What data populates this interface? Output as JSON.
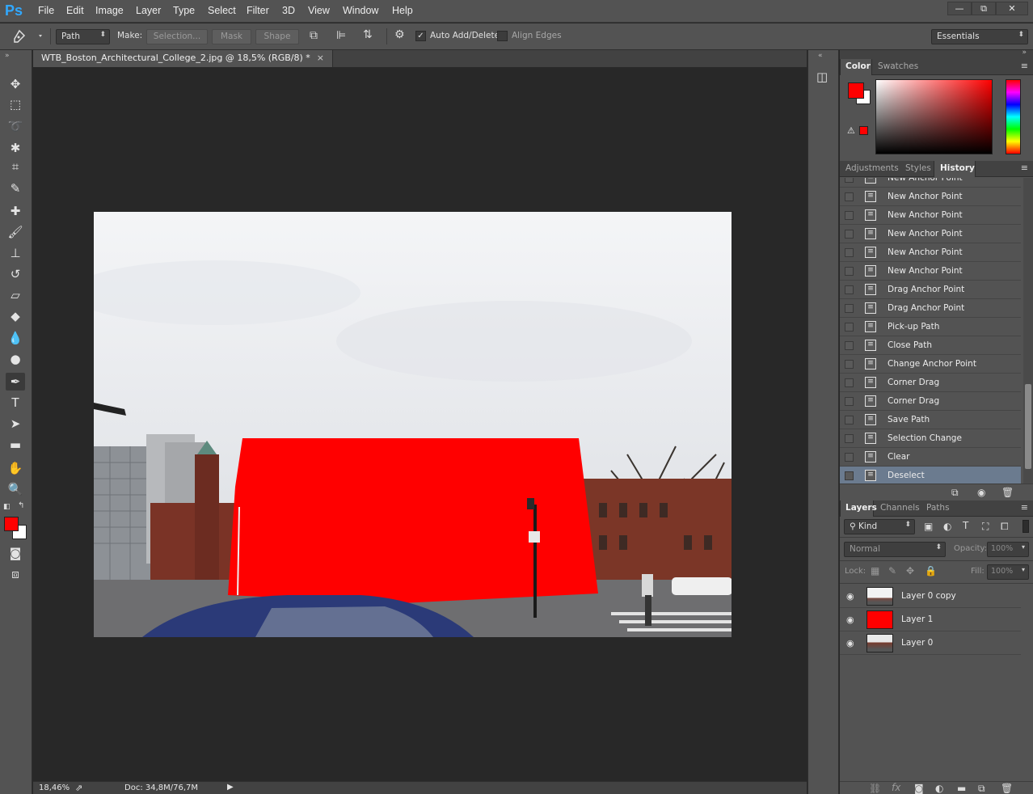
{
  "app": {
    "logo": "Ps"
  },
  "menu": [
    "File",
    "Edit",
    "Image",
    "Layer",
    "Type",
    "Select",
    "Filter",
    "3D",
    "View",
    "Window",
    "Help"
  ],
  "window_controls": {
    "minimize": "—",
    "restore": "⧉",
    "close": "✕"
  },
  "options_bar": {
    "mode_value": "Path",
    "make_label": "Make:",
    "selection_label": "Selection...",
    "mask_label": "Mask",
    "shape_label": "Shape",
    "auto_add_delete_label": "Auto Add/Delete",
    "auto_add_delete_checked": true,
    "align_edges_label": "Align Edges",
    "align_edges_checked": false,
    "workspace_value": "Essentials"
  },
  "document": {
    "tab_title": "WTB_Boston_Architectural_College_2.jpg @ 18,5% (RGB/8) *",
    "zoom": "18,46%",
    "doc_info": "Doc: 34,8M/76,7M"
  },
  "colors": {
    "foreground": "#ff0000",
    "background": "#ffffff",
    "accent": "#31a8ff",
    "fill_layer": "#ff0000",
    "history_selected": "#6b7b8f"
  },
  "color_panel": {
    "tabs": [
      "Color",
      "Swatches"
    ]
  },
  "history_panel": {
    "tabs": [
      "Adjustments",
      "Styles",
      "History"
    ],
    "items": [
      "New Anchor Point",
      "New Anchor Point",
      "New Anchor Point",
      "New Anchor Point",
      "New Anchor Point",
      "New Anchor Point",
      "Drag Anchor Point",
      "Drag Anchor Point",
      "Pick-up Path",
      "Close Path",
      "Change Anchor Point",
      "Corner Drag",
      "Corner Drag",
      "Save Path",
      "Selection Change",
      "Clear",
      "Deselect"
    ],
    "selected_index": 16
  },
  "layers_panel": {
    "tabs": [
      "Layers",
      "Channels",
      "Paths"
    ],
    "filter_value": "Kind",
    "blend_mode": "Normal",
    "opacity_label": "Opacity:",
    "opacity_value": "100%",
    "lock_label": "Lock:",
    "fill_label": "Fill:",
    "fill_value": "100%",
    "layers": [
      "Layer 0 copy",
      "Layer 1",
      "Layer 0"
    ]
  },
  "tools": [
    "move-tool",
    "marquee-tool",
    "lasso-tool",
    "magic-wand-tool",
    "crop-tool",
    "eyedropper-tool",
    "healing-brush-tool",
    "brush-tool",
    "clone-stamp-tool",
    "history-brush-tool",
    "eraser-tool",
    "paint-bucket-tool",
    "blur-tool",
    "dodge-tool",
    "pen-tool",
    "type-tool",
    "path-selection-tool",
    "rectangle-tool",
    "hand-tool",
    "zoom-tool"
  ],
  "tool_glyphs": [
    "✥",
    "⬚",
    "➰",
    "✱",
    "⌗",
    "✎",
    "✚",
    "🖌",
    "⊥",
    "↺",
    "▱",
    "◆",
    "💧",
    "●",
    "✒",
    "T",
    "➤",
    "▬",
    "✋",
    "🔍"
  ],
  "active_tool": "pen-tool"
}
